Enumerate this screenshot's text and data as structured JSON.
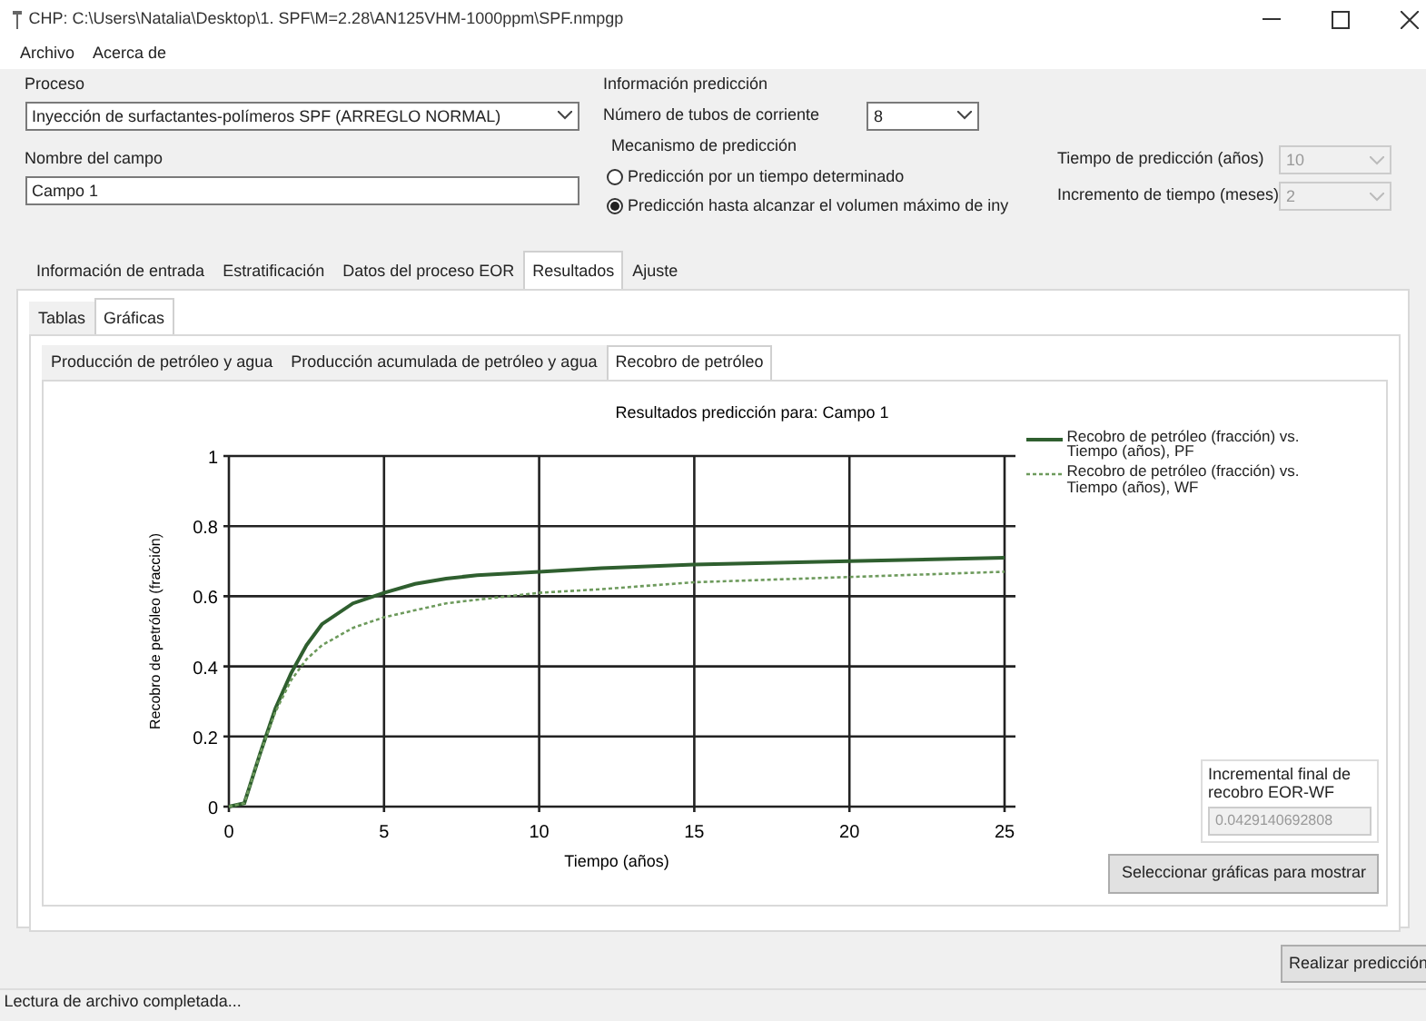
{
  "window": {
    "title": "CHP: C:\\Users\\Natalia\\Desktop\\1. SPF\\M=2.28\\AN125VHM-1000ppm\\SPF.nmpgp"
  },
  "menu": [
    "Archivo",
    "Acerca de"
  ],
  "proceso": {
    "label": "Proceso",
    "value": "Inyección de surfactantes-polímeros SPF (ARREGLO NORMAL)"
  },
  "nombre_campo": {
    "label": "Nombre del campo",
    "value": "Campo 1"
  },
  "prediccion": {
    "label": "Información predicción",
    "tubos_label": "Número de tubos de corriente",
    "tubos_value": "8",
    "mecanismo_label": "Mecanismo de predicción",
    "radios": [
      {
        "label": "Predicción por un tiempo determinado",
        "selected": false
      },
      {
        "label": "Predicción hasta alcanzar el volumen máximo de iny",
        "selected": true
      }
    ],
    "fields": [
      {
        "label": "Tiempo de predicción (años)",
        "value": "10",
        "disabled": true
      },
      {
        "label": "Incremento de tiempo (meses)",
        "value": "2",
        "disabled": true
      }
    ]
  },
  "tabs": [
    {
      "label": "Información de entrada",
      "selected": false
    },
    {
      "label": "Estratificación",
      "selected": false
    },
    {
      "label": "Datos del proceso EOR",
      "selected": false
    },
    {
      "label": "Resultados",
      "selected": true
    },
    {
      "label": "Ajuste",
      "selected": false
    }
  ],
  "subtabs": [
    {
      "label": "Tablas",
      "selected": false
    },
    {
      "label": "Gráficas",
      "selected": true
    }
  ],
  "chart_tabs": [
    {
      "label": "Producción de petróleo y agua",
      "selected": false
    },
    {
      "label": "Producción acumulada de petróleo y agua",
      "selected": false
    },
    {
      "label": "Recobro de petróleo",
      "selected": true
    }
  ],
  "chart_data": {
    "type": "line",
    "title": "Resultados predicción para: Campo 1",
    "xlabel": "Tiempo (años)",
    "ylabel": "Recobro de petróleo (fracción)",
    "x": [
      0,
      0.5,
      1,
      1.5,
      2,
      2.5,
      3,
      4,
      5,
      6,
      7,
      8,
      10,
      12,
      15,
      20,
      25
    ],
    "series": [
      {
        "name": "Recobro de petróleo (fracción) vs. Tiempo (años), PF",
        "color": "#2f5f2f",
        "line_style": "solid",
        "values": [
          0,
          0.01,
          0.15,
          0.28,
          0.38,
          0.46,
          0.52,
          0.58,
          0.61,
          0.635,
          0.65,
          0.66,
          0.67,
          0.68,
          0.69,
          0.7,
          0.71
        ]
      },
      {
        "name": "Recobro de petróleo (fracción) vs. Tiempo (años), WF",
        "color": "#6d9a5c",
        "line_style": "dashed",
        "values": [
          0,
          0.01,
          0.15,
          0.27,
          0.36,
          0.42,
          0.46,
          0.51,
          0.54,
          0.56,
          0.58,
          0.59,
          0.61,
          0.62,
          0.64,
          0.655,
          0.67
        ]
      }
    ],
    "grid": true,
    "xlim": [
      0,
      25
    ],
    "ylim": [
      0,
      1
    ],
    "xticks": [
      0,
      5,
      10,
      15,
      20,
      25
    ],
    "yticks": [
      0,
      0.2,
      0.4,
      0.6,
      0.8,
      1
    ]
  },
  "incremental": {
    "label": "Incremental final de recobro EOR-WF",
    "value": "0.0429140692808"
  },
  "select_button": "Seleccionar gráficas para mostrar",
  "run_button": "Realizar predicción",
  "status_bar": "Lectura de archivo completada..."
}
